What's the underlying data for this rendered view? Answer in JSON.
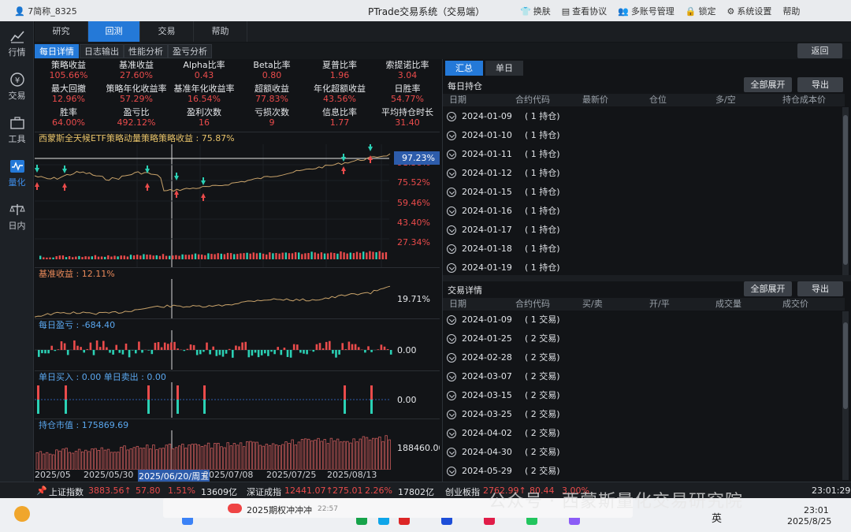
{
  "titlebar": {
    "user": "7简称_8325",
    "title": "PTrade交易系统（交易端）",
    "items": [
      "换肤",
      "查看协议",
      "多账号管理",
      "锁定",
      "系统设置",
      "帮助"
    ]
  },
  "sidebar": {
    "items": [
      {
        "label": "行情",
        "icon": "chart-icon"
      },
      {
        "label": "交易",
        "icon": "yuan-icon"
      },
      {
        "label": "工具",
        "icon": "toolbox-icon"
      },
      {
        "label": "量化",
        "icon": "waveform-icon",
        "active": true
      },
      {
        "label": "日内",
        "icon": "balance-icon"
      }
    ]
  },
  "maintabs": [
    "研究",
    "回测",
    "交易",
    "帮助"
  ],
  "active_main_tab": "回测",
  "subtabs": [
    "每日详情",
    "日志输出",
    "性能分析",
    "盈亏分析"
  ],
  "back_label": "返回",
  "metrics": [
    {
      "label": "策略收益",
      "value": "105.66%"
    },
    {
      "label": "基准收益",
      "value": "27.60%"
    },
    {
      "label": "Alpha比率",
      "value": "0.43"
    },
    {
      "label": "Beta比率",
      "value": "0.80"
    },
    {
      "label": "夏普比率",
      "value": "1.96"
    },
    {
      "label": "索提诺比率",
      "value": "3.04"
    },
    {
      "label": "最大回撤",
      "value": "12.96%"
    },
    {
      "label": "策略年化收益率",
      "value": "57.29%"
    },
    {
      "label": "基准年化收益率",
      "value": "16.54%"
    },
    {
      "label": "超额收益",
      "value": "77.83%"
    },
    {
      "label": "年化超额收益",
      "value": "43.56%"
    },
    {
      "label": "日胜率",
      "value": "54.77%"
    },
    {
      "label": "胜率",
      "value": "64.00%"
    },
    {
      "label": "盈亏比",
      "value": "492.12%"
    },
    {
      "label": "盈利次数",
      "value": "16"
    },
    {
      "label": "亏损次数",
      "value": "9"
    },
    {
      "label": "信息比率",
      "value": "1.77"
    },
    {
      "label": "平均持仓时长",
      "value": "31.40"
    }
  ],
  "panels": {
    "strategy": {
      "title": "西蒙斯全天候ETF策略动量策略策略收益 : 75.87%",
      "cursor_value": "97.23%",
      "ticks": [
        "91.38%",
        "75.52%",
        "59.46%",
        "43.40%",
        "27.34%"
      ]
    },
    "benchmark": {
      "title": "基准收益 : 12.11%",
      "tick": "19.71%"
    },
    "daily_pnl": {
      "title": "每日盈亏 : -684.40",
      "tick": "0.00"
    },
    "buy_sell": {
      "title": "单日买入 : 0.00  单日卖出 : 0.00",
      "tick": "0.00"
    },
    "holdings": {
      "title": "持仓市值 : 175869.69",
      "tick": "188460.00"
    }
  },
  "xaxis": {
    "labels": [
      "2025/05",
      "2025/05/30",
      "2025/06/20/周五",
      "2025/07/08",
      "2025/07/25",
      "2025/08/13"
    ]
  },
  "right": {
    "tabs": [
      "汇总",
      "单日"
    ],
    "daily_positions": {
      "title": "每日持仓",
      "expand_label": "全部展开",
      "export_label": "导出",
      "columns": [
        "日期",
        "合约代码",
        "最新价",
        "仓位",
        "多/空",
        "持仓成本价"
      ],
      "rows": [
        {
          "date": "2024-01-09",
          "count": "( 1 持仓)"
        },
        {
          "date": "2024-01-10",
          "count": "( 1 持仓)"
        },
        {
          "date": "2024-01-11",
          "count": "( 1 持仓)"
        },
        {
          "date": "2024-01-12",
          "count": "( 1 持仓)"
        },
        {
          "date": "2024-01-15",
          "count": "( 1 持仓)"
        },
        {
          "date": "2024-01-16",
          "count": "( 1 持仓)"
        },
        {
          "date": "2024-01-17",
          "count": "( 1 持仓)"
        },
        {
          "date": "2024-01-18",
          "count": "( 1 持仓)"
        },
        {
          "date": "2024-01-19",
          "count": "( 1 持仓)"
        }
      ]
    },
    "trade_details": {
      "title": "交易详情",
      "expand_label": "全部展开",
      "export_label": "导出",
      "columns": [
        "日期",
        "合约代码",
        "买/卖",
        "开/平",
        "成交量",
        "成交价"
      ],
      "rows": [
        {
          "date": "2024-01-09",
          "count": "( 1 交易)"
        },
        {
          "date": "2024-01-25",
          "count": "( 2 交易)"
        },
        {
          "date": "2024-02-28",
          "count": "( 2 交易)"
        },
        {
          "date": "2024-03-07",
          "count": "( 2 交易)"
        },
        {
          "date": "2024-03-15",
          "count": "( 2 交易)"
        },
        {
          "date": "2024-03-25",
          "count": "( 2 交易)"
        },
        {
          "date": "2024-04-02",
          "count": "( 2 交易)"
        },
        {
          "date": "2024-04-30",
          "count": "( 2 交易)"
        },
        {
          "date": "2024-05-29",
          "count": "( 2 交易)"
        }
      ]
    }
  },
  "statusbar": {
    "sh_name": "上证指数",
    "sh_value": "3883.56↑",
    "sh_change": "57.80",
    "sh_pct": "1.51%",
    "sh_amount": "13609亿",
    "sz_name": "深证成指",
    "sz_value": "12441.07↑",
    "sz_change": "275.01",
    "sz_pct": "2.26%",
    "sz_amount": "17802亿",
    "cy_name": "创业板指",
    "cy_value": "2762.99↑",
    "cy_change": "80.44",
    "cy_pct": "3.00%",
    "time": "23:01:29"
  },
  "taskbar": {
    "notif_text": "2025期权冲冲冲",
    "notif_time": "22:57",
    "ime": "英",
    "time": "23:01",
    "date": "2025/8/25"
  },
  "watermark": "公众号 · 西蒙斯量化交易研究院",
  "colors": {
    "accent": "#2479d8",
    "up": "#ea4b4b",
    "down": "#2bd1b5",
    "strategy_line": "#c9a36a"
  }
}
